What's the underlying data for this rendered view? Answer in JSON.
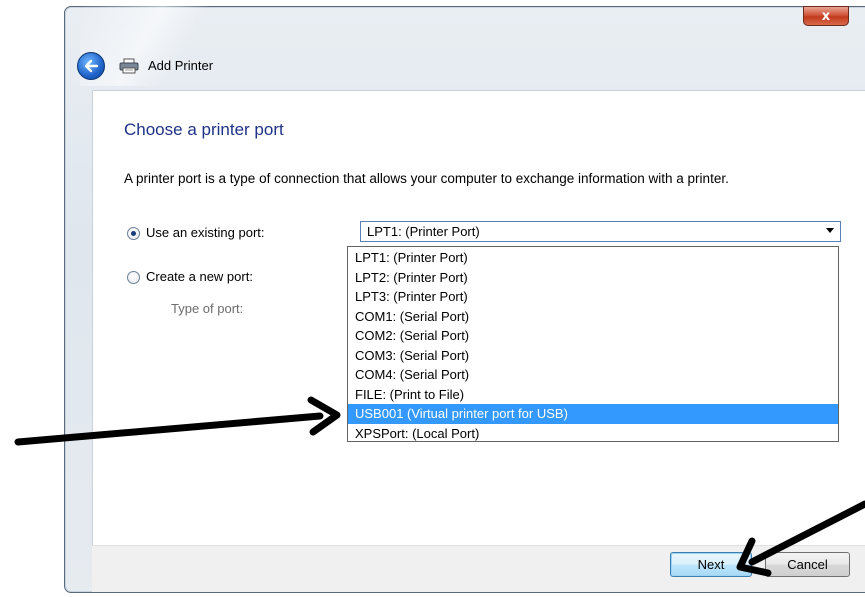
{
  "window": {
    "title": "Add Printer",
    "close_label": "x"
  },
  "page": {
    "heading": "Choose a printer port",
    "description": "A printer port is a type of connection that allows your computer to exchange information with a printer."
  },
  "options": {
    "existing_port_label": "Use an existing port:",
    "existing_port_selected": true,
    "new_port_label": "Create a new port:",
    "new_port_selected": false,
    "type_of_port_label": "Type of port:"
  },
  "port_combo": {
    "value": "LPT1: (Printer Port)",
    "items": [
      "LPT1: (Printer Port)",
      "LPT2: (Printer Port)",
      "LPT3: (Printer Port)",
      "COM1: (Serial Port)",
      "COM2: (Serial Port)",
      "COM3: (Serial Port)",
      "COM4: (Serial Port)",
      "FILE: (Print to File)",
      "USB001 (Virtual printer port for USB)",
      "XPSPort: (Local Port)"
    ],
    "highlighted_item": "USB001 (Virtual printer port for USB)"
  },
  "footer": {
    "next_label": "Next",
    "cancel_label": "Cancel"
  },
  "colors": {
    "heading": "#1e3287",
    "highlight": "#3399ff",
    "annotation_arrow": "#000000"
  }
}
